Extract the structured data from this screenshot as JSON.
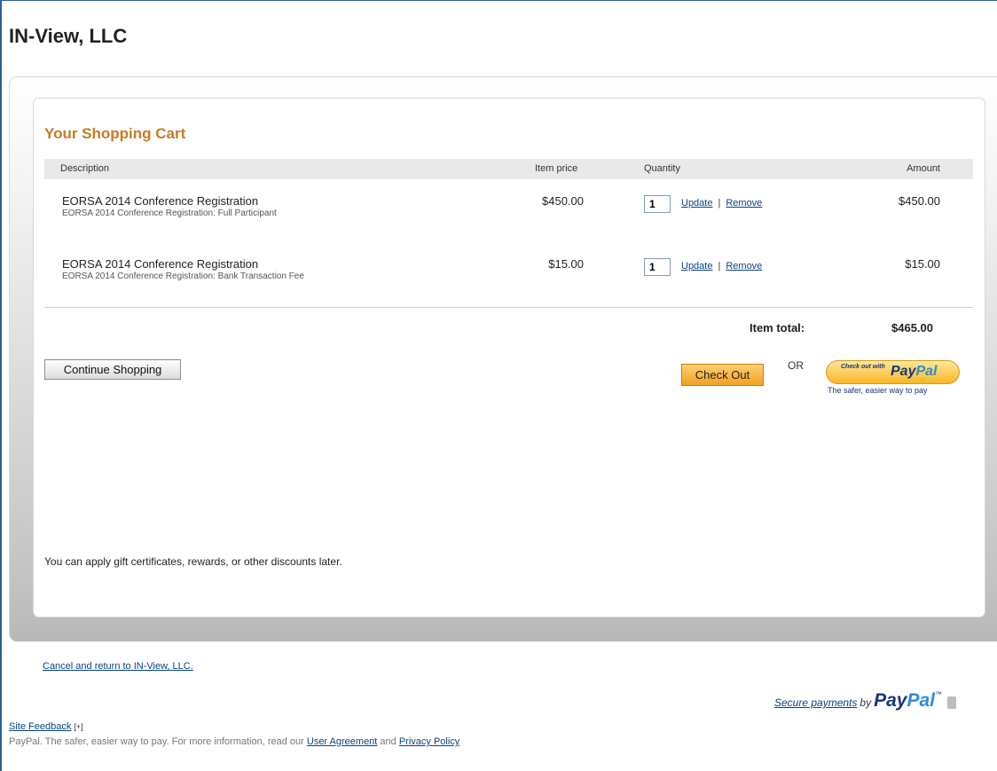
{
  "merchant": {
    "title": "IN-View, LLC"
  },
  "cart": {
    "heading": "Your Shopping Cart",
    "columns": {
      "description": "Description",
      "item_price": "Item price",
      "quantity": "Quantity",
      "amount": "Amount"
    },
    "items": [
      {
        "name": "EORSA 2014 Conference Registration",
        "detail": "EORSA 2014 Conference Registration: Full Participant",
        "price": "$450.00",
        "quantity": "1",
        "update_label": "Update",
        "separator": "|",
        "remove_label": "Remove",
        "amount": "$450.00"
      },
      {
        "name": "EORSA 2014 Conference Registration",
        "detail": "EORSA 2014 Conference Registration: Bank Transaction Fee",
        "price": "$15.00",
        "quantity": "1",
        "update_label": "Update",
        "separator": "|",
        "remove_label": "Remove",
        "amount": "$15.00"
      }
    ],
    "total_label": "Item total:",
    "total_value": "$465.00"
  },
  "actions": {
    "continue_label": "Continue Shopping",
    "checkout_label": "Check Out",
    "or_label": "OR",
    "paypal_button_small": "Check out with",
    "paypal_button_logo_pay": "Pay",
    "paypal_button_logo_pal": "Pal",
    "paypal_tagline": "The safer, easier way to pay"
  },
  "gift_note": "You can apply gift certificates, rewards, or other discounts later.",
  "footer": {
    "cancel_link": "Cancel and return to IN-View, LLC.",
    "secure_link": "Secure payments",
    "secure_by": "by",
    "secure_logo_pay": "Pay",
    "secure_logo_pal": "Pal",
    "trademark": "™",
    "feedback_link": "Site Feedback",
    "feedback_plus": "[+]",
    "legal_text": "PayPal. The safer, easier way to pay. For more information, read our",
    "user_agreement": "User Agreement",
    "and_text": "and",
    "privacy_policy": "Privacy Policy"
  },
  "colors": {
    "heading": "#c87a26",
    "link": "#084482",
    "paypal_blue": "#19357a",
    "paypal_light_blue": "#2e8ad6",
    "checkout_orange": "#f2a020"
  },
  "icons": [
    "lock-icon"
  ]
}
